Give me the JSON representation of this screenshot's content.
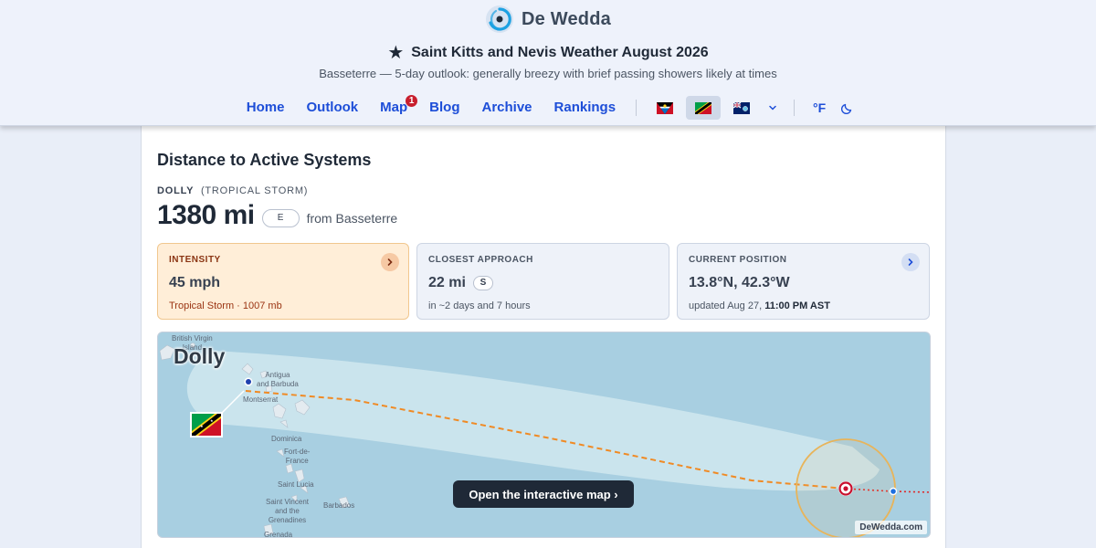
{
  "brand": {
    "name": "De Wedda"
  },
  "header": {
    "title": "Saint Kitts and Nevis Weather August 2026",
    "subtitle": "Basseterre — 5-day outlook: generally breezy with brief passing showers likely at times"
  },
  "nav": {
    "items": [
      {
        "label": "Home"
      },
      {
        "label": "Outlook"
      },
      {
        "label": "Map",
        "badge": "1"
      },
      {
        "label": "Blog"
      },
      {
        "label": "Archive"
      },
      {
        "label": "Rankings"
      }
    ],
    "unit_label": "°F"
  },
  "section": {
    "title": "Distance to Active Systems"
  },
  "storm": {
    "name": "DOLLY",
    "type": "(TROPICAL STORM)",
    "distance": "1380 mi",
    "direction": "E",
    "from": "from Basseterre",
    "map_label": "Dolly"
  },
  "tiles": {
    "intensity": {
      "label": "Intensity",
      "value": "45 mph",
      "sub": "Tropical Storm · 1007 mb"
    },
    "closest": {
      "label": "Closest Approach",
      "value": "22 mi",
      "direction": "S",
      "sub": "in ~2 days and 7 hours"
    },
    "position": {
      "label": "Current Position",
      "value": "13.8°N, 42.3°W",
      "sub_prefix": "updated Aug 27,",
      "sub_time": "11:00 PM AST"
    }
  },
  "map": {
    "labels": {
      "bvi_1": "British Virgin",
      "bvi_2": "Island",
      "antigua_1": "Antigua",
      "antigua_2": "and Barbuda",
      "montserrat": "Montserrat",
      "dominica": "Dominica",
      "fort_1": "Fort-de-",
      "fort_2": "France",
      "st_lucia": "Saint Lucia",
      "sv_1": "Saint Vincent",
      "sv_2": "and the",
      "sv_3": "Grenadines",
      "barbados": "Barbados",
      "grenada": "Grenada"
    },
    "cta": "Open the interactive map ›",
    "watermark": "DeWedda.com"
  }
}
